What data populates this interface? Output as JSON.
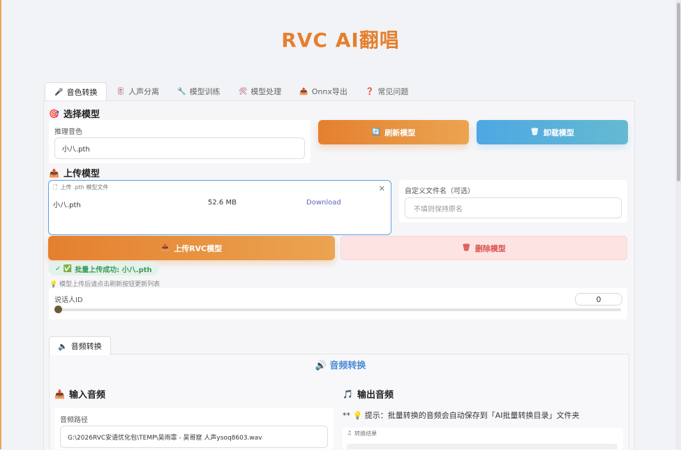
{
  "app_title": "RVC AI翻唱",
  "tabs": [
    {
      "label": "音色转换",
      "icon": "microphone-icon",
      "glyph": "🎤"
    },
    {
      "label": "人声分离",
      "icon": "split-icon",
      "glyph": "🎚"
    },
    {
      "label": "模型训练",
      "icon": "train-icon",
      "glyph": "🔧"
    },
    {
      "label": "模型处理",
      "icon": "tools-icon",
      "glyph": "🛠"
    },
    {
      "label": "Onnx导出",
      "icon": "export-icon",
      "glyph": "📤"
    },
    {
      "label": "常见问题",
      "icon": "question-icon",
      "glyph": "❓"
    }
  ],
  "select_model": {
    "title": "选择模型",
    "field_label": "推理音色",
    "field_value": "小八.pth",
    "refresh_button": "刷新模型",
    "unload_button": "卸载模型"
  },
  "upload_model": {
    "title": "上传模型",
    "dropzone_label": "上传 .pth 模型文件",
    "file_name": "小八.pth",
    "file_size": "52.6 MB",
    "download_link": "Download",
    "custom_name_label": "自定义文件名（可选）",
    "custom_name_placeholder": "不填则保持原名",
    "upload_button": "上传RVC模型",
    "delete_button": "删除模型",
    "success_badge": "批量上传成功: 小八.pth",
    "hint": "模型上传后请点击刷新按钮更新列表"
  },
  "speaker": {
    "label": "说话人ID",
    "value": "0",
    "slider_fraction": 0
  },
  "audio_convert": {
    "subtab_label": "音频转换",
    "heading": "音频转换",
    "input_title": "输入音频",
    "path_label": "音频路径",
    "path_value": "G:\\2026RVC安语优化包\\TEMP\\吴雨霏 - 吴哥窟 人声ysoq8603.wav",
    "output_title": "输出音频",
    "tip": "** 💡 提示：批量转换的音频会自动保存到「AI批量转换目录」文件夹",
    "result_label": "转换结果"
  },
  "colors": {
    "accent_orange": "#e57f2d",
    "accent_blue": "#4ea7e3",
    "success_green": "#3a9a5b",
    "danger_red": "#d9534f"
  }
}
